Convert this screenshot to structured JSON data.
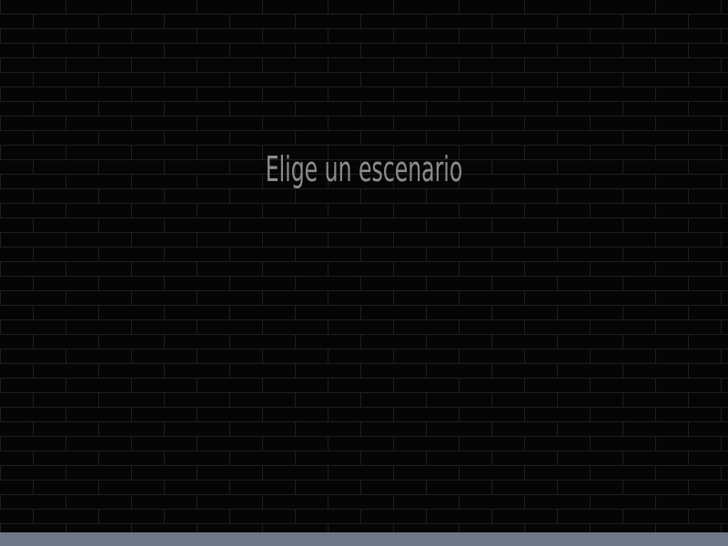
{
  "screen": {
    "title": "Elige un escenario"
  },
  "colors": {
    "background": "#050505",
    "brick_line": "#1e1e1e",
    "title_text": "#8c8c8c",
    "bottom_bar": "#6f7686"
  }
}
